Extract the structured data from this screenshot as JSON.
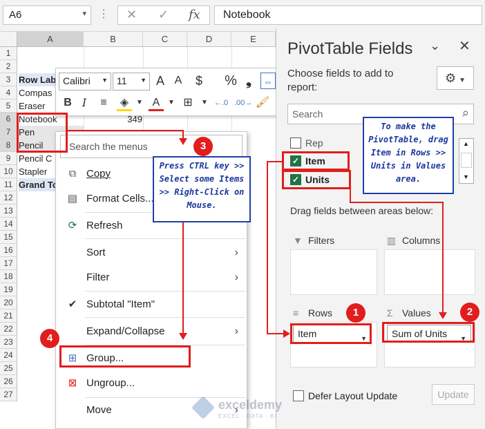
{
  "formula_bar": {
    "name_box": "A6",
    "cancel_icon": "✕",
    "enter_icon": "✓",
    "fx_label": "fx",
    "value": "Notebook"
  },
  "columns": [
    "A",
    "B",
    "C",
    "D",
    "E"
  ],
  "rows": [
    "1",
    "2",
    "3",
    "4",
    "5",
    "6",
    "7",
    "8",
    "9",
    "10",
    "11",
    "12",
    "13",
    "14",
    "15",
    "16",
    "17",
    "18",
    "19",
    "20",
    "21",
    "22",
    "23",
    "24",
    "25",
    "26",
    "27"
  ],
  "cells": {
    "row3": "Row Lab",
    "row4": "Compas",
    "row5": "Eraser",
    "row6": "Notebook",
    "row6_b": "349",
    "row7": "Pen",
    "row8": "Pencil",
    "row9": "Pencil C",
    "row10": "Stapler",
    "row11": "Grand To"
  },
  "mini_toolbar": {
    "font_name": "Calibri",
    "font_size": "11",
    "grow_font": "A",
    "shrink_font": "A",
    "currency": "$",
    "percent": "%",
    "comma": "❟",
    "bold": "B",
    "italic": "I",
    "font_color": "A"
  },
  "context_menu": {
    "search_placeholder": "Search the menus",
    "items": [
      {
        "label": "Copy"
      },
      {
        "label": "Format Cells..."
      },
      {
        "label": "Refresh"
      },
      {
        "label": "Sort"
      },
      {
        "label": "Filter"
      },
      {
        "label": "Subtotal \"Item\""
      },
      {
        "label": "Expand/Collapse"
      },
      {
        "label": "Group..."
      },
      {
        "label": "Ungroup..."
      },
      {
        "label": "Move"
      }
    ]
  },
  "pivot_pane": {
    "title": "PivotTable Fields",
    "choose_label": "Choose fields to add to report:",
    "search_placeholder": "Search",
    "fields": [
      {
        "label": "Rep",
        "checked": false
      },
      {
        "label": "Item",
        "checked": true
      },
      {
        "label": "Units",
        "checked": true
      }
    ],
    "drag_label": "Drag fields between areas below:",
    "areas": {
      "filters": "Filters",
      "columns": "Columns",
      "rows": "Rows",
      "values": "Values"
    },
    "rows_chip": "Item",
    "values_chip": "Sum of Units",
    "defer_label": "Defer Layout Update",
    "update_label": "Update"
  },
  "annotations": {
    "note_left": "Press CTRL key >> Select some Items >> Right-Click on Mouse.",
    "note_right": "To make the PivotTable, drag Item in Rows >> Units in Values area.",
    "badges": [
      "1",
      "2",
      "3",
      "4"
    ]
  },
  "watermark": {
    "name": "exceldemy",
    "tagline": "EXCEL · DATA · BI"
  },
  "colors": {
    "annotation_red": "#e11d1d",
    "note_blue": "#1f3fa8",
    "excel_green": "#217346",
    "row_label_fill": "#dde6f5"
  }
}
